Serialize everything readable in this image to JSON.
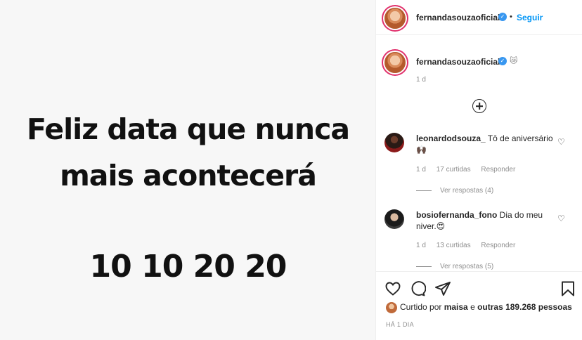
{
  "post_image": {
    "line1": "Feliz data que nunca",
    "line2": "mais acontecerá",
    "date": "10 10 20 20"
  },
  "header": {
    "username": "fernandasouzaoficial",
    "separator": "•",
    "follow_label": "Seguir"
  },
  "caption": {
    "username": "fernandasouzaoficial",
    "emoji": "😿",
    "time": "1 d"
  },
  "comments": [
    {
      "username": "leonardodsouza_",
      "text": " Tô de aniversário 🙌🏿",
      "time": "1 d",
      "likes": "17 curtidas",
      "reply": "Responder",
      "view_replies": "Ver respostas (4)"
    },
    {
      "username": "bosiofernanda_fono",
      "text": " Dia do meu niver.😍",
      "time": "1 d",
      "likes": "13 curtidas",
      "reply": "Responder",
      "view_replies": "Ver respostas (5)"
    }
  ],
  "actions": {
    "liked_by_prefix": "Curtido por ",
    "liked_by_user": "maisa",
    "liked_by_mid": " e ",
    "liked_by_others": "outras 189.268 pessoas",
    "time_ago": "HÁ 1 DIA"
  },
  "colors": {
    "accent": "#0095f6",
    "verified": "#3897f0",
    "muted": "#8e8e8e"
  },
  "icons": [
    "verified-icon",
    "add-comment-icon",
    "heart-icon",
    "comment-icon",
    "share-icon",
    "bookmark-icon"
  ]
}
